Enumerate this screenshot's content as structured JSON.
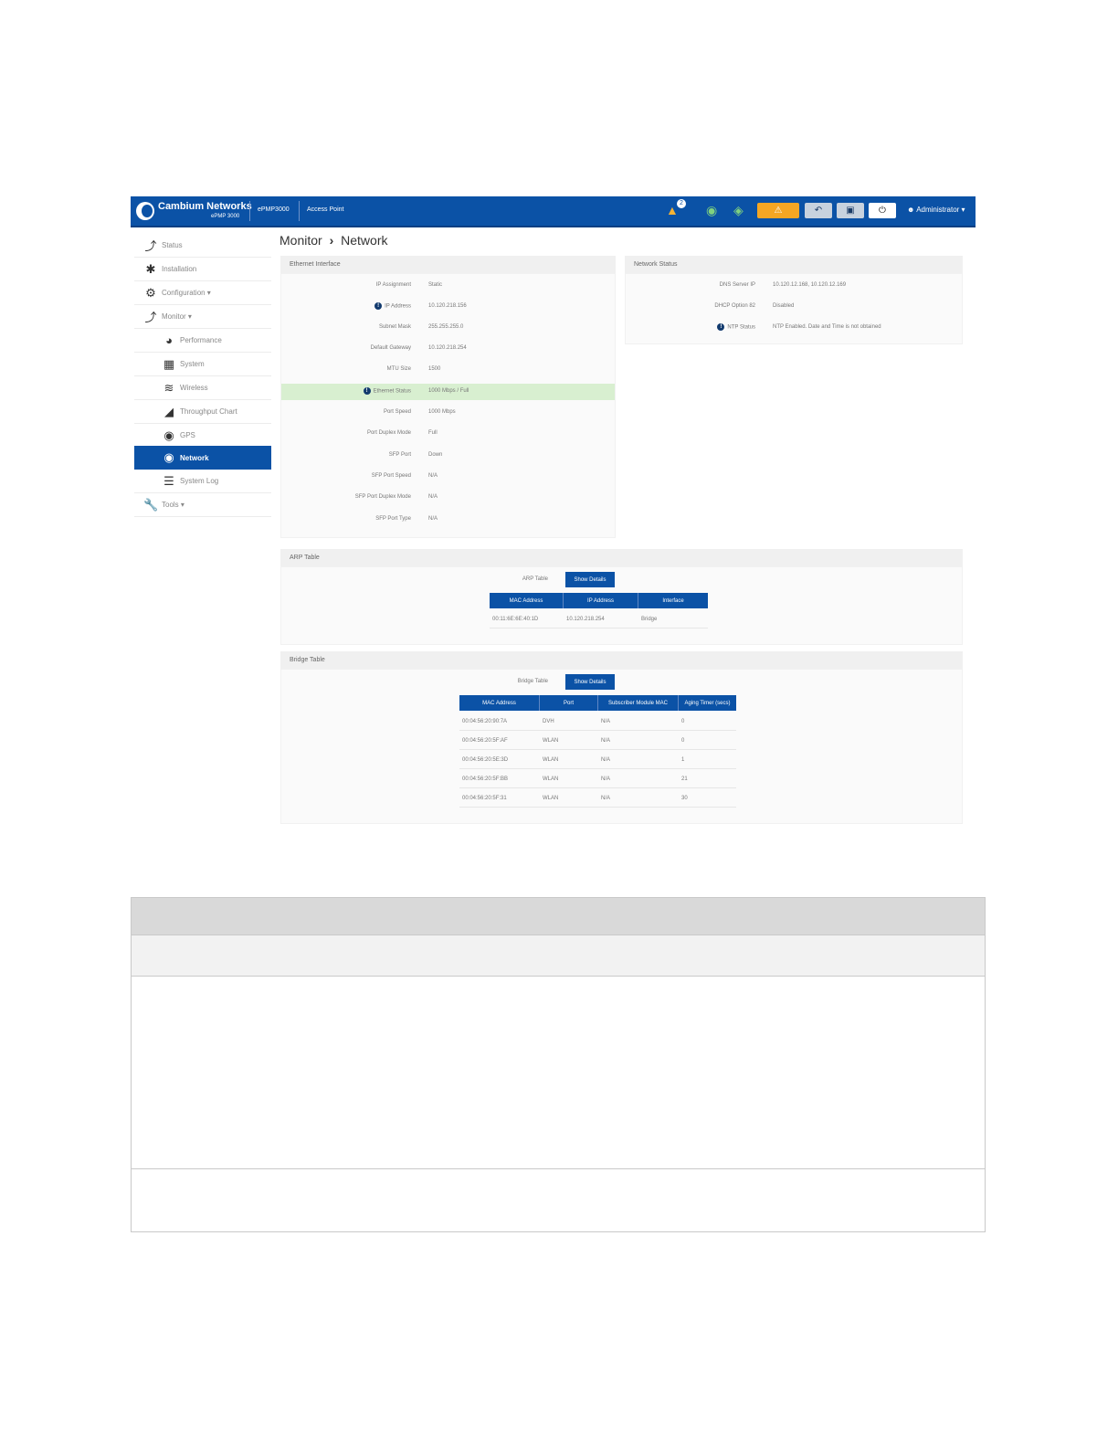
{
  "header": {
    "brand": "Cambium Networks",
    "brand_sub": "ePMP 3000",
    "device": "ePMP3000",
    "mode": "Access Point",
    "alert_count": "2",
    "admin": "Administrator ▾",
    "accent": "#0b52a6",
    "icons": [
      "alert-icon",
      "globe-icon",
      "shield-icon",
      "warning-icon",
      "undo-icon",
      "save-icon",
      "power-icon",
      "user-icon"
    ]
  },
  "sidebar": {
    "items": [
      {
        "label": "Status",
        "icon": "pulse-icon"
      },
      {
        "label": "Installation",
        "icon": "runner-icon"
      },
      {
        "label": "Configuration ▾",
        "icon": "gear-icon"
      },
      {
        "label": "Monitor ▾",
        "icon": "pulse-icon"
      },
      {
        "label": "Performance",
        "icon": "gauge-icon"
      },
      {
        "label": "System",
        "icon": "system-icon"
      },
      {
        "label": "Wireless",
        "icon": "wifi-icon"
      },
      {
        "label": "Throughput Chart",
        "icon": "area-chart-icon"
      },
      {
        "label": "GPS",
        "icon": "gps-icon"
      },
      {
        "label": "Network",
        "icon": "network-icon"
      },
      {
        "label": "System Log",
        "icon": "list-icon"
      },
      {
        "label": "Tools ▾",
        "icon": "wrench-icon"
      }
    ]
  },
  "breadcrumb": {
    "parent": "Monitor",
    "sep": "›",
    "current": "Network"
  },
  "ethernet": {
    "title": "Ethernet Interface",
    "rows": [
      {
        "label": "IP Assignment",
        "value": "Static"
      },
      {
        "label": "IP Address",
        "value": "10.120.218.156"
      },
      {
        "label": "Subnet Mask",
        "value": "255.255.255.0"
      },
      {
        "label": "Default Gateway",
        "value": "10.120.218.254"
      },
      {
        "label": "MTU Size",
        "value": "1500"
      },
      {
        "label": "Ethernet Status",
        "value": "1000 Mbps / Full"
      },
      {
        "label": "Port Speed",
        "value": "1000 Mbps"
      },
      {
        "label": "Port Duplex Mode",
        "value": "Full"
      },
      {
        "label": "SFP Port",
        "value": "Down"
      },
      {
        "label": "SFP Port Speed",
        "value": "N/A"
      },
      {
        "label": "SFP Port Duplex Mode",
        "value": "N/A"
      },
      {
        "label": "SFP Port Type",
        "value": "N/A"
      }
    ]
  },
  "network_status": {
    "title": "Network Status",
    "rows": [
      {
        "label": "DNS Server IP",
        "value": "10.120.12.168, 10.120.12.169"
      },
      {
        "label": "DHCP Option 82",
        "value": "Disabled"
      },
      {
        "label": "NTP Status",
        "value": "NTP Enabled. Date and Time is not obtained"
      }
    ]
  },
  "arp": {
    "title": "ARP Table",
    "label": "ARP Table",
    "button": "Show Details",
    "columns": [
      "MAC Address",
      "IP Address",
      "Interface"
    ],
    "rows": [
      [
        "00:11:6E:6E:40:1D",
        "10.120.218.254",
        "Bridge"
      ]
    ]
  },
  "bridge": {
    "title": "Bridge Table",
    "label": "Bridge Table",
    "button": "Show Details",
    "columns": [
      "MAC Address",
      "Port",
      "Subscriber Module MAC",
      "Aging Timer (secs)"
    ],
    "rows": [
      [
        "00:04:56:20:90:7A",
        "DVH",
        "N/A",
        "0"
      ],
      [
        "00:04:56:20:5F:AF",
        "WLAN",
        "N/A",
        "0"
      ],
      [
        "00:04:56:20:5E:3D",
        "WLAN",
        "N/A",
        "1"
      ],
      [
        "00:04:56:20:5F:BB",
        "WLAN",
        "N/A",
        "21"
      ],
      [
        "00:04:56:20:5F:31",
        "WLAN",
        "N/A",
        "30"
      ]
    ]
  }
}
